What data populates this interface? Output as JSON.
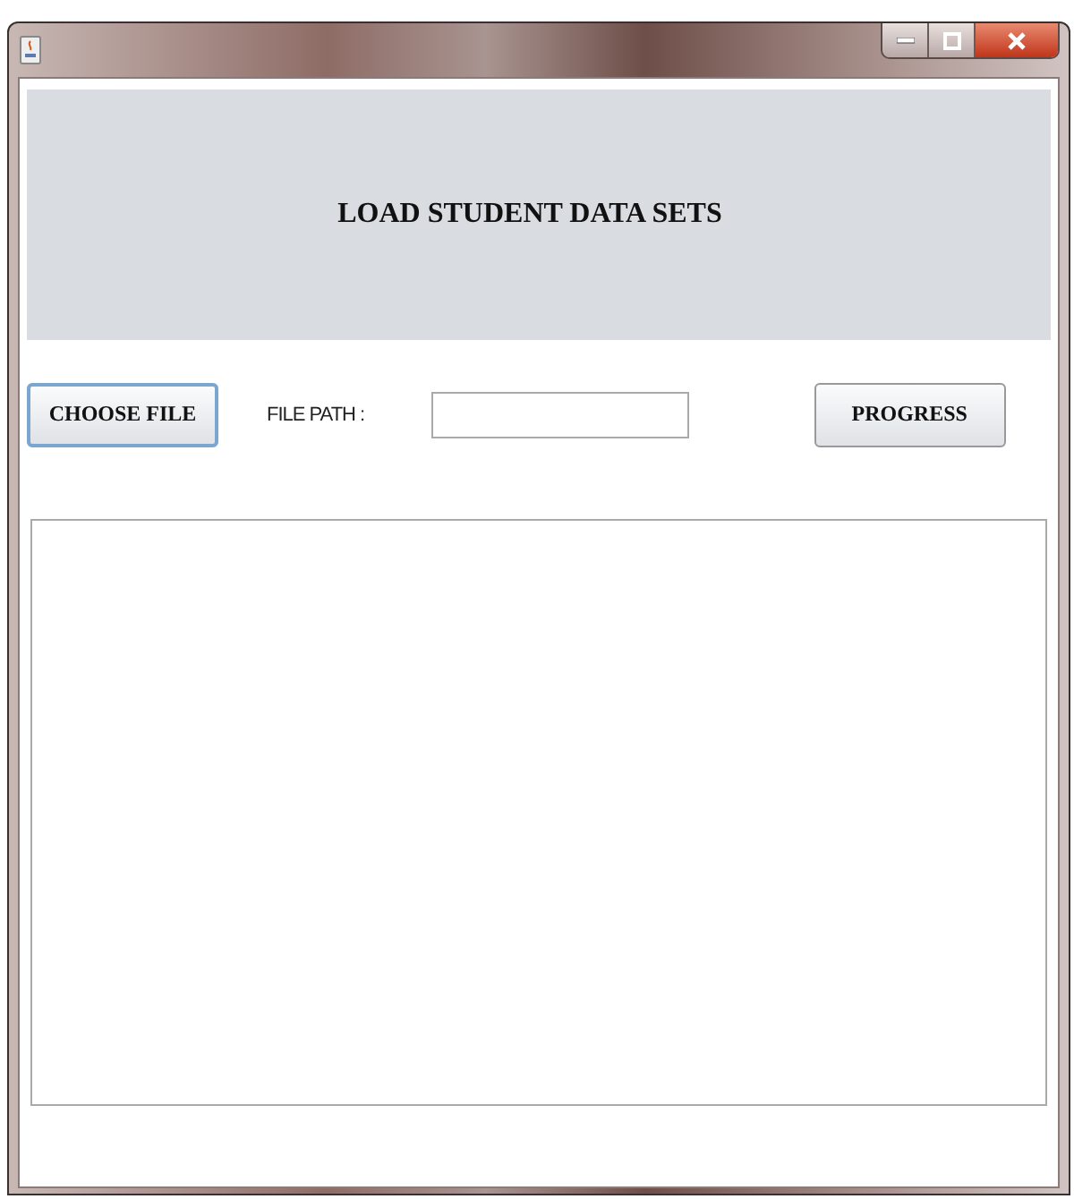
{
  "header": {
    "title": "LOAD STUDENT DATA SETS"
  },
  "toolbar": {
    "choose_button": {
      "label": "CHOOSE FILE",
      "focused": true
    },
    "path_label": "FILE PATH :",
    "progress_button": {
      "label": "PROGRESS",
      "focused": false
    }
  }
}
